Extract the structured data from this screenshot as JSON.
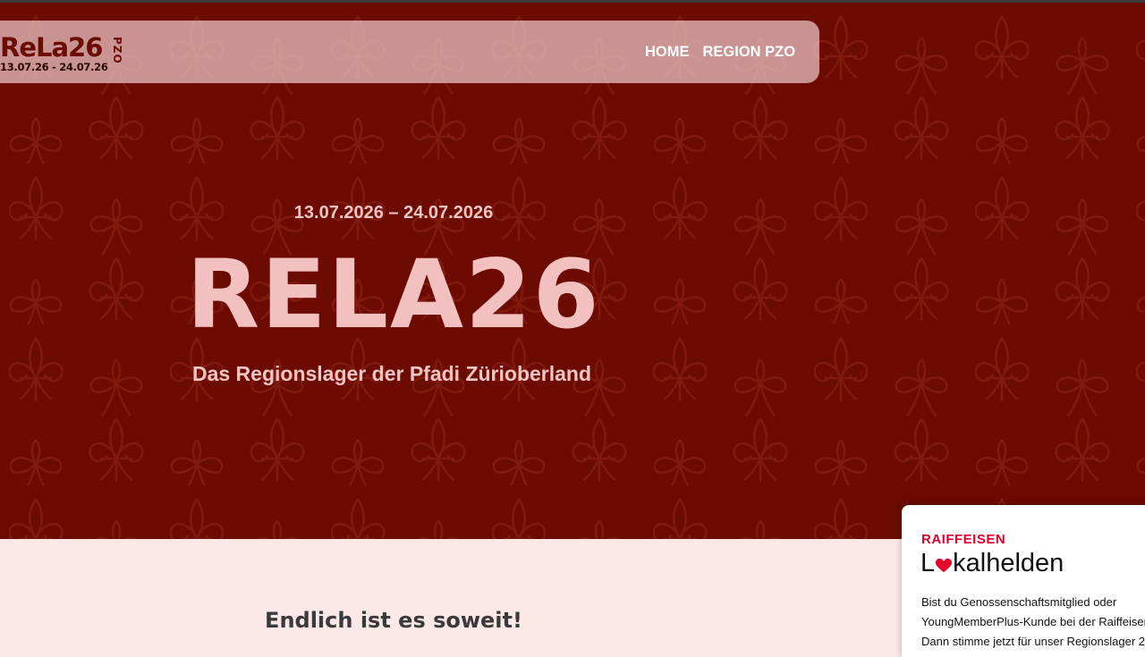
{
  "logo": {
    "main": "ReLa26",
    "dates": "13.07.26 - 24.07.26",
    "region": "PZO"
  },
  "nav": {
    "items": [
      {
        "label": "HOME"
      },
      {
        "label": "REGION PZO"
      }
    ]
  },
  "hero": {
    "date": "13.07.2026 – 24.07.2026",
    "title": "RELA26",
    "subtitle": "Das Regionslager der Pfadi Züriober­land"
  },
  "section": {
    "heading": "Endlich ist es soweit!"
  },
  "widget": {
    "brand": "RAIFFEISEN",
    "title_start": "L",
    "title_end": "kalhelden",
    "lines": [
      "Bist du Genossenschaftsmitglied oder",
      "YoungMemberPlus-Kunde bei der Raiffeisen",
      "Dann stimme jetzt für unser Regionslager 2"
    ]
  },
  "colors": {
    "hero_bg": "#6b0b02",
    "hero_text": "#f3c0c0",
    "page_bg": "#fde8e8",
    "raiffeisen_red": "#e4002b"
  },
  "icons": {
    "pattern": "fleur-de-lis-and-clover-pattern",
    "heart": "heart-icon"
  }
}
